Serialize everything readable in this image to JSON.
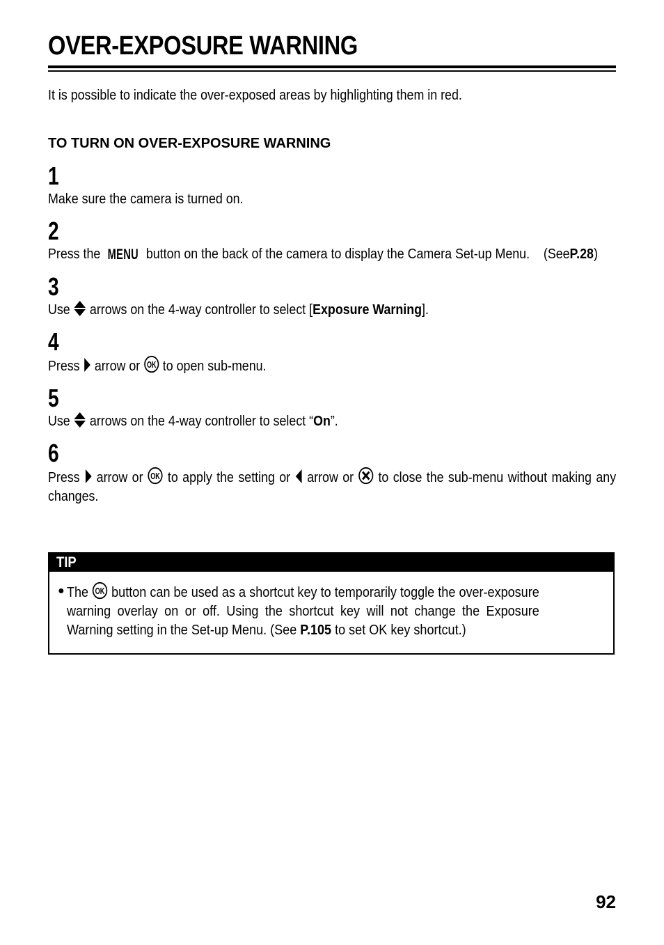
{
  "document": {
    "title": "OVER-EXPOSURE WARNING",
    "intro": "It is possible to indicate the over-exposed areas by highlighting them in red.",
    "subheading": "TO TURN ON OVER-EXPOSURE WARNING",
    "page_number": "92"
  },
  "steps": [
    {
      "number": "1",
      "text": "Make sure the camera is turned on."
    },
    {
      "number": "2",
      "text_before_menu": "Press the",
      "menu_label": "MENU",
      "text_after_menu": "button on the back of the camera to display the Camera Set-up Menu.",
      "see_prefix": "(See",
      "see_ref": "P.28",
      "see_suffix": ")"
    },
    {
      "number": "3",
      "text_before": "Use",
      "icon": "updown-arrow-icon",
      "text_middle": "arrows on the 4-way controller to select [",
      "bold_value": "Exposure Warning",
      "text_after": "]."
    },
    {
      "number": "4",
      "text_before": "Press",
      "icon_right": "right-arrow-icon",
      "text_middle": "arrow or",
      "icon_ok": "ok-button-icon",
      "text_after": "to open sub-menu."
    },
    {
      "number": "5",
      "text_before": "Use",
      "icon": "updown-arrow-icon",
      "text_middle": "arrows on the 4-way controller to select “",
      "bold_value": "On",
      "text_after": "”."
    },
    {
      "number": "6",
      "text_1": "Press",
      "icon_right": "right-arrow-icon",
      "text_2": "arrow or",
      "icon_ok": "ok-button-icon",
      "text_3": "to apply the setting or",
      "icon_left": "left-arrow-icon",
      "text_4": "arrow or",
      "icon_close": "close-button-icon",
      "text_5": "to close the sub-menu without making any changes."
    }
  ],
  "tip": {
    "header": "TIP",
    "bullet": "●",
    "text_1": "The",
    "icon_ok": "ok-button-icon",
    "text_2": "button can be used as a shortcut key to temporarily toggle the over-exposure warning overlay on or off.  Using the shortcut key will not change the Exposure Warning setting in the Set-up Menu.  (See",
    "ref": "P.105",
    "text_3": "to set OK key shortcut.)"
  }
}
